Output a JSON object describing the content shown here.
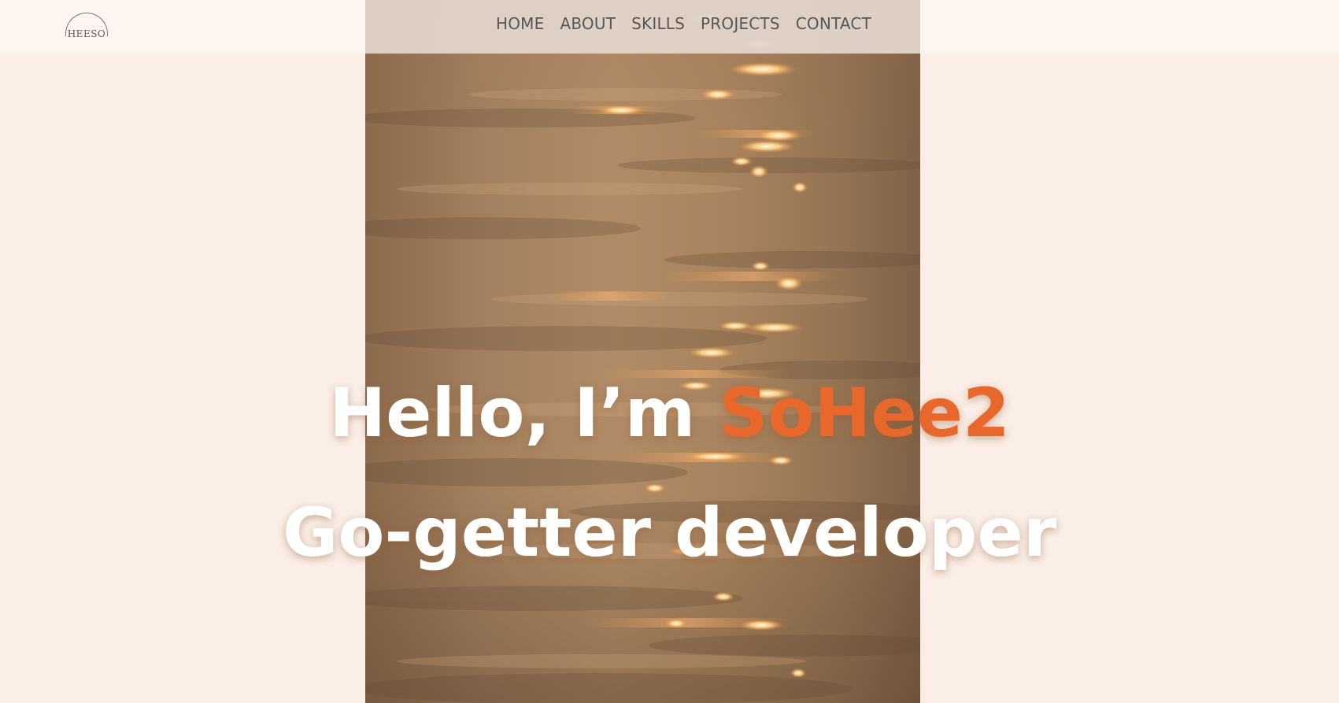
{
  "logo": {
    "text": "HEESO",
    "icon": "arc-logo-icon"
  },
  "nav": {
    "items": [
      {
        "label": "HOME"
      },
      {
        "label": "ABOUT"
      },
      {
        "label": "SKILLS"
      },
      {
        "label": "PROJECTS"
      },
      {
        "label": "CONTACT"
      }
    ]
  },
  "hero": {
    "greeting": "Hello, I’m ",
    "name": "SoHee2",
    "tagline": "Go-getter developer",
    "image": "sunlit-water-photo"
  },
  "colors": {
    "background": "#faeee6",
    "accent": "#e8682c",
    "nav_text": "#5b5652",
    "heading": "#ffffff"
  }
}
